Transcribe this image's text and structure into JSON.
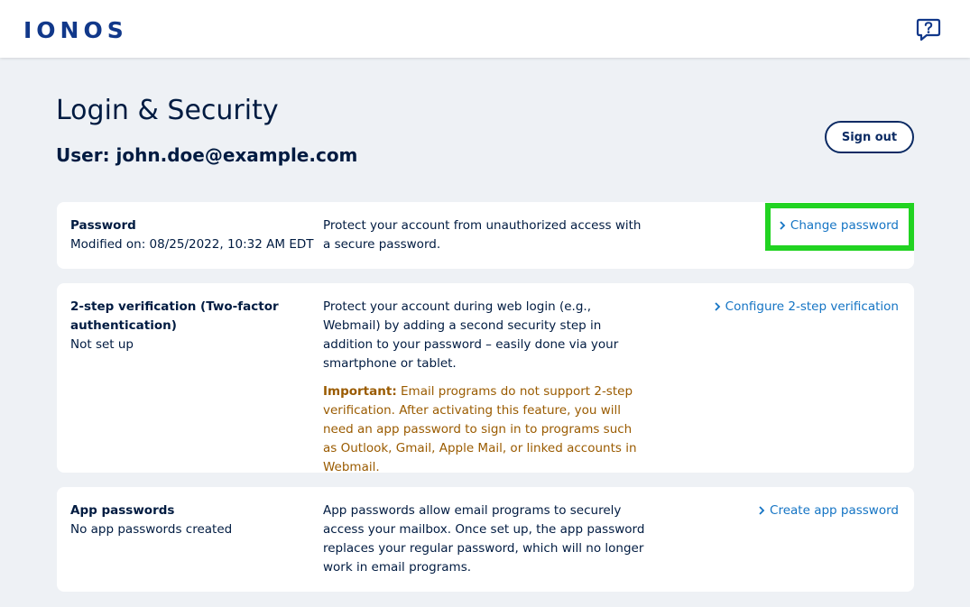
{
  "header": {
    "logo_text": "IONOS",
    "help_icon": "question-bubble-icon",
    "brand_color": "#11388a"
  },
  "page": {
    "title": "Login & Security",
    "user_label": "User: john.doe@example.com",
    "signout_label": "Sign out"
  },
  "sections": {
    "password": {
      "title": "Password",
      "meta": "Modified on: 08/25/2022, 10:32 AM EDT",
      "description": "Protect your account from unauthorized access with a secure password.",
      "action": "Change password"
    },
    "two_step": {
      "title": "2-step verification (Two-factor authentication)",
      "meta": "Not set up",
      "description": "Protect your account during web login (e.g., Webmail) by adding a second security step in addition to your password – easily done via your smartphone or tablet.",
      "warning_label": "Important:",
      "warning_text": " Email programs do not support 2-step verification. After activating this feature, you will need an app password to sign in to programs such as Outlook, Gmail, Apple Mail, or linked accounts in Webmail.",
      "action": "Configure 2-step verification"
    },
    "app_passwords": {
      "title": "App passwords",
      "meta": "No app passwords created",
      "description": "App passwords allow email programs to securely access your mailbox. Once set up, the app password replaces your regular password, which will no longer work in email programs.",
      "action": "Create app password"
    }
  },
  "colors": {
    "link": "#1474c4",
    "warning": "#9a5b00",
    "highlight": "#21d321",
    "background": "#eef1f5"
  }
}
